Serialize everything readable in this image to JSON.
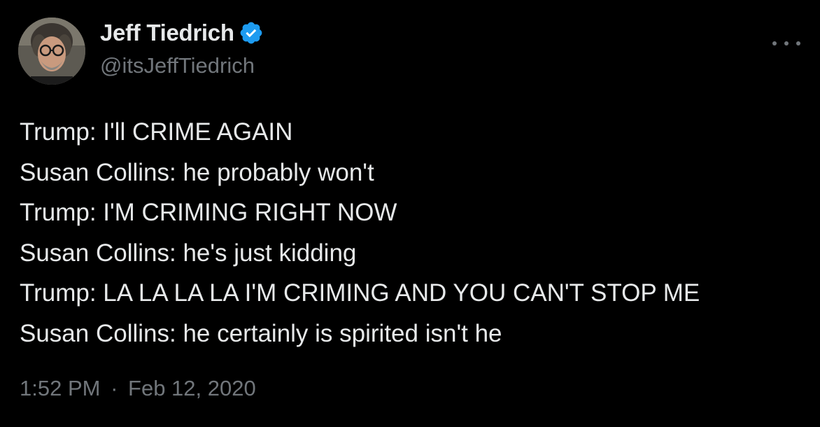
{
  "author": {
    "display_name": "Jeff Tiedrich",
    "handle": "@itsJeffTiedrich",
    "verified_icon": "verified-badge-icon",
    "verified_color": "#1d9bf0"
  },
  "tweet": {
    "lines": [
      "Trump: I'll CRIME AGAIN",
      "Susan Collins: he probably won't",
      "Trump: I'M CRIMING RIGHT NOW",
      "Susan Collins: he's just kidding",
      "Trump: LA LA LA LA I'M CRIMING AND YOU CAN'T STOP ME",
      "Susan Collins: he certainly is spirited isn't he"
    ],
    "time": "1:52 PM",
    "separator": "·",
    "date": "Feb 12, 2020"
  },
  "menu": {
    "icon": "more-icon"
  },
  "colors": {
    "background": "#000000",
    "primary_text": "#e7e9ea",
    "secondary_text": "#71767b"
  }
}
